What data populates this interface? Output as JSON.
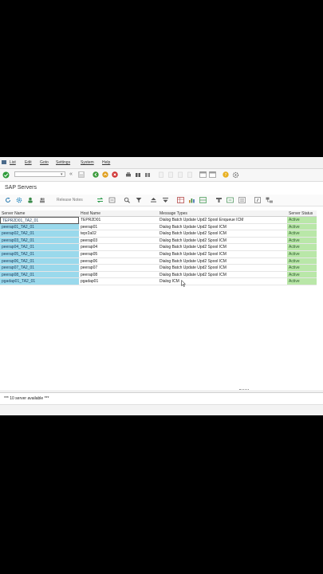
{
  "menu": {
    "items": [
      "List",
      "Edit",
      "Goto",
      "Settings",
      "System",
      "Help"
    ]
  },
  "command_field": {
    "value": ""
  },
  "page_title": "SAP Servers",
  "toolbar": {
    "release_notes": "Release Notes"
  },
  "table": {
    "headers": [
      "Server Name",
      "Host Name",
      "Message Types",
      "Server Status"
    ],
    "rows": [
      {
        "server": "TEPR2D01_TA2_01",
        "host": "TEPR2D01",
        "messages": "Dialog Batch Update Upd2 Spool Enqueue ICM",
        "status": "Active"
      },
      {
        "server": "peerap01_TA2_01",
        "host": "peerap01",
        "messages": "Dialog Batch Update Upd2 Spool ICM",
        "status": "Active"
      },
      {
        "server": "peerap02_TA2_01",
        "host": "tepr2a02",
        "messages": "Dialog Batch Update Upd2 Spool ICM",
        "status": "Active"
      },
      {
        "server": "peerap03_TA2_01",
        "host": "peerap03",
        "messages": "Dialog Batch Update Upd2 Spool ICM",
        "status": "Active"
      },
      {
        "server": "peerap04_TA2_01",
        "host": "peerap04",
        "messages": "Dialog Batch Update Upd2 Spool ICM",
        "status": "Active"
      },
      {
        "server": "peerap05_TA2_01",
        "host": "peerap05",
        "messages": "Dialog Batch Update Upd2 Spool ICM",
        "status": "Active"
      },
      {
        "server": "peerap06_TA2_01",
        "host": "peerap06",
        "messages": "Dialog Batch Update Upd2 Spool ICM",
        "status": "Active"
      },
      {
        "server": "peerap07_TA2_01",
        "host": "peerap07",
        "messages": "Dialog Batch Update Upd2 Spool ICM",
        "status": "Active"
      },
      {
        "server": "peerap08_TA2_01",
        "host": "peerap08",
        "messages": "Dialog Batch Update Upd2 Spool ICM",
        "status": "Active"
      },
      {
        "server": "pgadap01_TA2_01",
        "host": "pgadap01",
        "messages": "Dialog ICM",
        "status": "Active"
      }
    ]
  },
  "status_bar": {
    "message": "*** 10 server available ***"
  },
  "colors": {
    "server_cell": "#9ad9ec",
    "status_active": "#b9e7a8",
    "enter_icon": "#2e9c3a",
    "back_icon": "#3a9a3a",
    "exit_icon": "#e0a020",
    "cancel_icon": "#d03030"
  }
}
